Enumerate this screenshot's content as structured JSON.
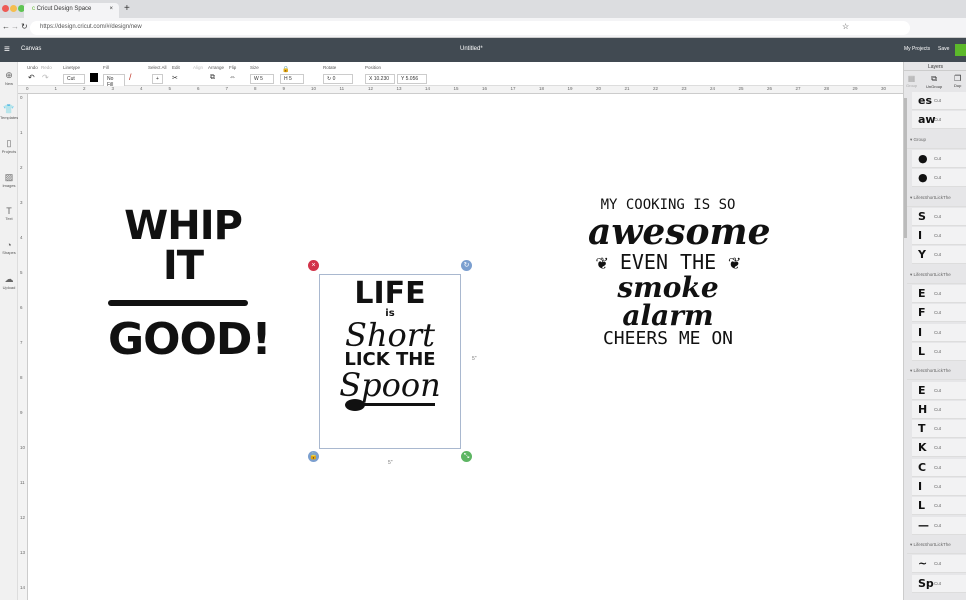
{
  "browser": {
    "tab_title": "Cricut Design Space",
    "url": "https://design.cricut.com/#/design/new",
    "new_tab": "+"
  },
  "header": {
    "menu_label": "Canvas",
    "title": "Untitled*",
    "my_projects": "My Projects",
    "save": "Save",
    "accent": "#5cb82a"
  },
  "toolbar": {
    "undo": "Undo",
    "redo": "Redo",
    "linetype_label": "Linetype",
    "linetype_value": "Cut",
    "fill_label": "Fill",
    "fill_value": "No Fill",
    "select_all": "Select All",
    "edit": "Edit",
    "align": "Align",
    "arrange": "Arrange",
    "flip": "Flip",
    "size_label": "Size",
    "w_label": "W",
    "w_value": "5",
    "h_label": "H",
    "h_value": "5",
    "rotate_label": "Rotate",
    "rotate_value": "0",
    "position_label": "Position",
    "x_label": "X",
    "x_value": "10.230",
    "y_label": "Y",
    "y_value": "5.056"
  },
  "sidebar": [
    {
      "label": "New",
      "icon": "⊕"
    },
    {
      "label": "Templates",
      "icon": "👕"
    },
    {
      "label": "Projects",
      "icon": "▯"
    },
    {
      "label": "Images",
      "icon": "▨"
    },
    {
      "label": "Text",
      "icon": "T"
    },
    {
      "label": "Shapes",
      "icon": "◔"
    },
    {
      "label": "Upload",
      "icon": "☁"
    }
  ],
  "ruler_h": [
    "0",
    "1",
    "2",
    "3",
    "4",
    "5",
    "6",
    "7",
    "8",
    "9",
    "10",
    "11",
    "12",
    "13",
    "14",
    "15",
    "16",
    "17",
    "18",
    "19",
    "20",
    "21",
    "22",
    "23",
    "24",
    "25",
    "26",
    "27",
    "28",
    "29",
    "30"
  ],
  "ruler_v": [
    "0",
    "1",
    "2",
    "3",
    "4",
    "5",
    "6",
    "7",
    "8",
    "9",
    "10",
    "11",
    "12",
    "13",
    "14"
  ],
  "canvas": {
    "whip": {
      "line1": "WHIP IT",
      "line2": "GOOD!"
    },
    "spoon": {
      "line1": "LIFE",
      "line2": "is",
      "line3": "Short",
      "line4": "LICK THE",
      "line5": "Spoon",
      "width_label": "5\"",
      "height_label": "5\""
    },
    "cooking": {
      "line1": "MY COOKING IS SO",
      "line2": "awesome",
      "line3": "EVEN THE",
      "line4": "smoke alarm",
      "line5": "CHEERS ME ON"
    }
  },
  "layers": {
    "title": "Layers",
    "group_btn": "Group",
    "ungroup_btn": "UnGroup",
    "dup_btn": "Dup",
    "items": [
      {
        "type": "row",
        "glyph": "es",
        "label": "Cut"
      },
      {
        "type": "row",
        "glyph": "aw",
        "label": "Cut"
      },
      {
        "type": "group",
        "label": "Group"
      },
      {
        "type": "row",
        "glyph": "●",
        "label": "Cut"
      },
      {
        "type": "row",
        "glyph": "●",
        "label": "Cut"
      },
      {
        "type": "group",
        "label": "LifeIsShortLickThe"
      },
      {
        "type": "row",
        "glyph": "S",
        "label": "Cut"
      },
      {
        "type": "row",
        "glyph": "I",
        "label": "Cut"
      },
      {
        "type": "row",
        "glyph": "Y",
        "label": "Cut"
      },
      {
        "type": "group",
        "label": "LifeIsShortLickThe"
      },
      {
        "type": "row",
        "glyph": "E",
        "label": "Cut"
      },
      {
        "type": "row",
        "glyph": "F",
        "label": "Cut"
      },
      {
        "type": "row",
        "glyph": "I",
        "label": "Cut"
      },
      {
        "type": "row",
        "glyph": "L",
        "label": "Cut"
      },
      {
        "type": "group",
        "label": "LifeIsShortLickThe"
      },
      {
        "type": "row",
        "glyph": "E",
        "label": "Cut"
      },
      {
        "type": "row",
        "glyph": "H",
        "label": "Cut"
      },
      {
        "type": "row",
        "glyph": "T",
        "label": "Cut"
      },
      {
        "type": "row",
        "glyph": "K",
        "label": "Cut"
      },
      {
        "type": "row",
        "glyph": "C",
        "label": "Cut"
      },
      {
        "type": "row",
        "glyph": "I",
        "label": "Cut"
      },
      {
        "type": "row",
        "glyph": "L",
        "label": "Cut"
      },
      {
        "type": "row",
        "glyph": "—",
        "label": "Cut"
      },
      {
        "type": "group",
        "label": "LifeIsShortLickThe"
      },
      {
        "type": "row",
        "glyph": "~",
        "label": "Cut"
      },
      {
        "type": "row",
        "glyph": "Sp",
        "label": "Cut"
      }
    ]
  }
}
